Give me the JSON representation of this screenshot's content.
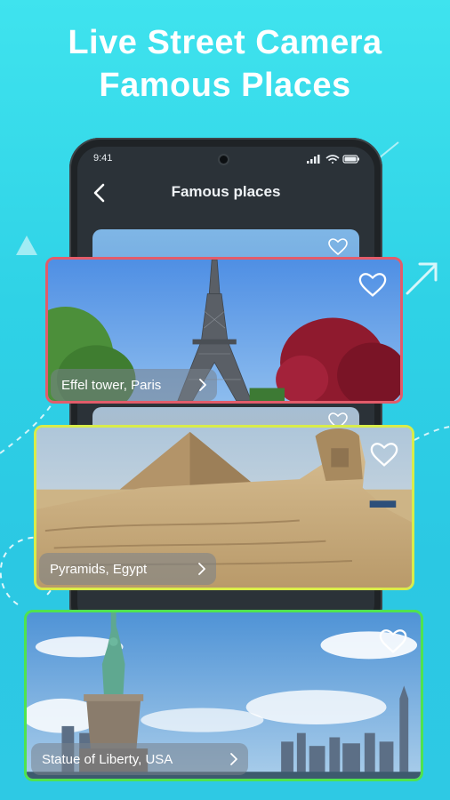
{
  "headline": {
    "line1": "Live Street Camera",
    "line2": "Famous Places"
  },
  "phone": {
    "status_time": "9:41",
    "title": "Famous places"
  },
  "places": [
    {
      "name": "Effel tower, Paris",
      "favorite": false
    },
    {
      "name": "Pyramids, Egypt",
      "favorite": false
    },
    {
      "name": "Statue of Liberty, USA",
      "favorite": false
    }
  ],
  "colors": {
    "background": "#33d4e8",
    "card_border_1": "#e25c6a",
    "card_border_2": "#d9ec4a",
    "card_border_3": "#4fe34f",
    "phone_body": "#1f2326"
  },
  "icons": [
    "back-arrow-icon",
    "heart-outline-icon",
    "chevron-right-icon",
    "signal-icon",
    "wifi-icon",
    "battery-icon"
  ]
}
